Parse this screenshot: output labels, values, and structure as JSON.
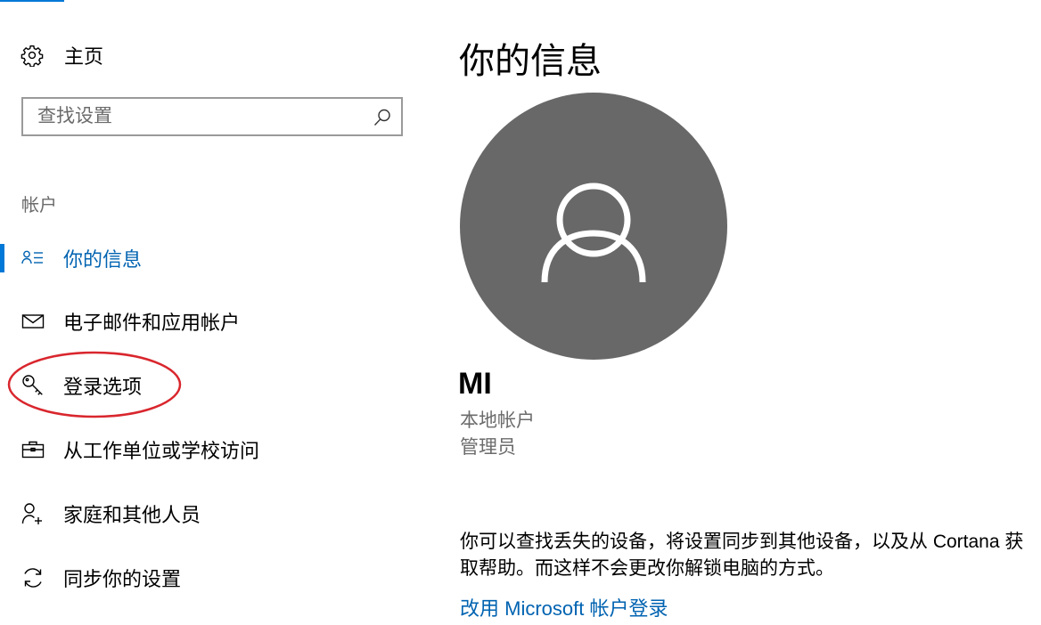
{
  "sidebar": {
    "home_label": "主页",
    "search_placeholder": "查找设置",
    "section_label": "帐户",
    "items": [
      {
        "label": "你的信息",
        "icon": "user-info-icon",
        "active": true
      },
      {
        "label": "电子邮件和应用帐户",
        "icon": "mail-icon"
      },
      {
        "label": "登录选项",
        "icon": "key-icon"
      },
      {
        "label": "从工作单位或学校访问",
        "icon": "briefcase-icon"
      },
      {
        "label": "家庭和其他人员",
        "icon": "add-person-icon"
      },
      {
        "label": "同步你的设置",
        "icon": "sync-icon"
      }
    ]
  },
  "main": {
    "title": "你的信息",
    "user_name": "MI",
    "account_type": "本地帐户",
    "account_role": "管理员",
    "description": "你可以查找丢失的设备，将设置同步到其他设备，以及从 Cortana 获取帮助。而这样不会更改你解锁电脑的方式。",
    "link_label": "改用 Microsoft 帐户登录"
  },
  "colors": {
    "accent": "#0078d7",
    "link": "#0063b1",
    "avatar_bg": "#686868",
    "annotation": "#d9262d"
  }
}
